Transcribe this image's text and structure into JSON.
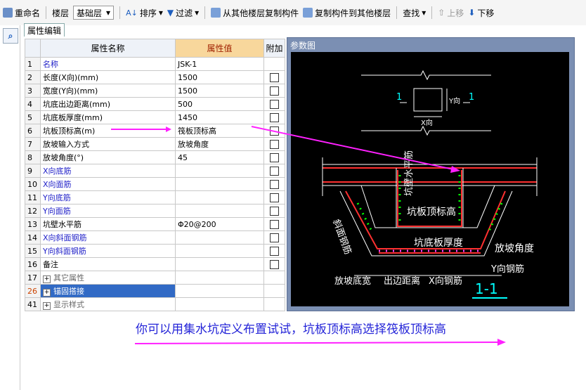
{
  "toolbar": {
    "rename": "重命名",
    "floor_label": "楼层",
    "floor_value": "基础层",
    "sort": "排序",
    "filter": "过滤",
    "copy_from": "从其他楼层复制构件",
    "copy_to": "复制构件到其他楼层",
    "find": "查找",
    "move_up": "上移",
    "move_down": "下移"
  },
  "tab": "属性编辑",
  "grid": {
    "headers": {
      "name": "属性名称",
      "value": "属性值",
      "extra": "附加"
    },
    "rows": [
      {
        "num": "1",
        "name": "名称",
        "value": "JSK-1"
      },
      {
        "num": "2",
        "name": "长度(X向)(mm)",
        "value": "1500"
      },
      {
        "num": "3",
        "name": "宽度(Y向)(mm)",
        "value": "1500"
      },
      {
        "num": "4",
        "name": "坑底出边距离(mm)",
        "value": "500"
      },
      {
        "num": "5",
        "name": "坑底板厚度(mm)",
        "value": "1450"
      },
      {
        "num": "6",
        "name": "坑板顶标高(m)",
        "value": "筏板顶标高"
      },
      {
        "num": "7",
        "name": "放坡输入方式",
        "value": "放坡角度"
      },
      {
        "num": "8",
        "name": "放坡角度(°)",
        "value": "45"
      },
      {
        "num": "9",
        "name": "X向底筋",
        "value": ""
      },
      {
        "num": "10",
        "name": "X向面筋",
        "value": ""
      },
      {
        "num": "11",
        "name": "Y向底筋",
        "value": ""
      },
      {
        "num": "12",
        "name": "Y向面筋",
        "value": ""
      },
      {
        "num": "13",
        "name": "坑壁水平筋",
        "value": "Φ20@200"
      },
      {
        "num": "14",
        "name": "X向斜面钢筋",
        "value": ""
      },
      {
        "num": "15",
        "name": "Y向斜面钢筋",
        "value": ""
      },
      {
        "num": "16",
        "name": "备注",
        "value": ""
      },
      {
        "num": "17",
        "name": "其它属性",
        "value": ""
      },
      {
        "num": "26",
        "name": "锚固搭接",
        "value": ""
      },
      {
        "num": "41",
        "name": "显示样式",
        "value": ""
      }
    ]
  },
  "panel": {
    "title": "参数图",
    "labels": {
      "section_mark": "1",
      "y_dir": "Y向",
      "x_dir": "X向",
      "wall_rebar": "坑壁水平筋",
      "top_elev": "坑板顶标高",
      "slope_rebar": "斜面钢筋",
      "bottom_thick": "坑底板厚度",
      "slope_angle": "放坡角度",
      "y_rebar": "Y向钢筋",
      "slope_width": "放坡底宽",
      "edge_dist": "出边距离",
      "x_rebar": "X向钢筋",
      "section_title": "1-1"
    }
  },
  "comment": "你可以用集水坑定义布置试试，坑板顶标高选择筏板顶标高",
  "colors": {
    "annotation": "#ff20ff",
    "comment_text": "#2525d8",
    "selection": "#316ac5"
  }
}
